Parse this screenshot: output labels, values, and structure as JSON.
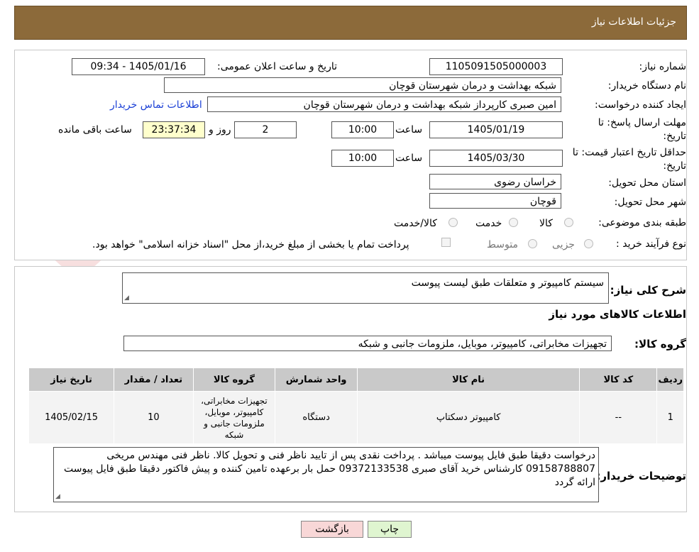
{
  "header": {
    "title": "جزئیات اطلاعات نیاز"
  },
  "form": {
    "need_number_label": "شماره نیاز:",
    "need_number": "1105091505000003",
    "announce_label": "تاریخ و ساعت اعلان عمومی:",
    "announce_value": "1405/01/16 - 09:34",
    "buyer_org_label": "نام دستگاه خریدار:",
    "buyer_org": "شبکه بهداشت و درمان شهرستان قوچان",
    "creator_label": "ایجاد کننده درخواست:",
    "creator": "امین صبری کارپرداز شبکه بهداشت و درمان شهرستان قوچان",
    "contact_link": "اطلاعات تماس خریدار",
    "deadline_label_1": "مهلت ارسال پاسخ: تا",
    "deadline_label_2": "تاریخ:",
    "deadline_date": "1405/01/19",
    "time_label": "ساعت",
    "deadline_time": "10:00",
    "days_value": "2",
    "days_label": "روز و",
    "remaining_time": "23:37:34",
    "remaining_label": "ساعت باقی مانده",
    "validity_label_1": "حداقل تاریخ اعتبار قیمت: تا",
    "validity_label_2": "تاریخ:",
    "validity_date": "1405/03/30",
    "validity_time": "10:00",
    "province_label": "استان محل تحویل:",
    "province": "خراسان رضوی",
    "city_label": "شهر محل تحویل:",
    "city": "قوچان",
    "category_label": "طبقه بندی موضوعی:",
    "category_options": [
      "کالا",
      "خدمت",
      "کالا/خدمت"
    ],
    "process_label": "نوع فرآیند خرید :",
    "process_options": [
      "جزیی",
      "متوسط"
    ],
    "payment_note": "پرداخت تمام یا بخشی از مبلغ خرید،از محل \"اسناد خزانه اسلامی\" خواهد بود."
  },
  "section2": {
    "general_desc_label": "شرح کلی نیاز:",
    "general_desc": "سیستم کامپیوتر و متعلقات طبق لیست پیوست",
    "goods_info_title": "اطلاعات کالاهای مورد نیاز",
    "goods_group_label": "گروه کالا:",
    "goods_group": "تجهیزات مخابراتی، کامپیوتر، موبایل، ملزومات جانبی و شبکه",
    "table": {
      "headers": [
        "ردیف",
        "کد کالا",
        "نام کالا",
        "واحد شمارش",
        "گروه کالا",
        "تعداد / مقدار",
        "تاریخ نیاز"
      ],
      "rows": [
        [
          "1",
          "--",
          "کامپیوتر دسکتاپ",
          "دستگاه",
          "تجهیزات مخابراتی، کامپیوتر، موبایل، ملزومات جانبی و شبکه",
          "10",
          "1405/02/15"
        ]
      ]
    },
    "buyer_notes_label": "توضیحات خریدار:",
    "buyer_notes": "درخواست دقیقا طبق فایل پیوست میباشد . پرداخت نقدی پس از تایید ناظر فنی و تحویل کالا. ناظر فنی مهندس مریخی 09158788807 کارشناس خرید آقای صبری 09372133538 حمل بار برعهده تامین کننده و پیش فاکتور دقیقا طبق فایل پیوست ارائه گردد"
  },
  "buttons": {
    "print": "چاپ",
    "back": "بازگشت"
  },
  "colors": {
    "header_bg": "#8c6a3a",
    "link": "#1a3fd6",
    "back_button_bg": "#f8d7d7",
    "print_button_bg": "#dff5d0"
  }
}
